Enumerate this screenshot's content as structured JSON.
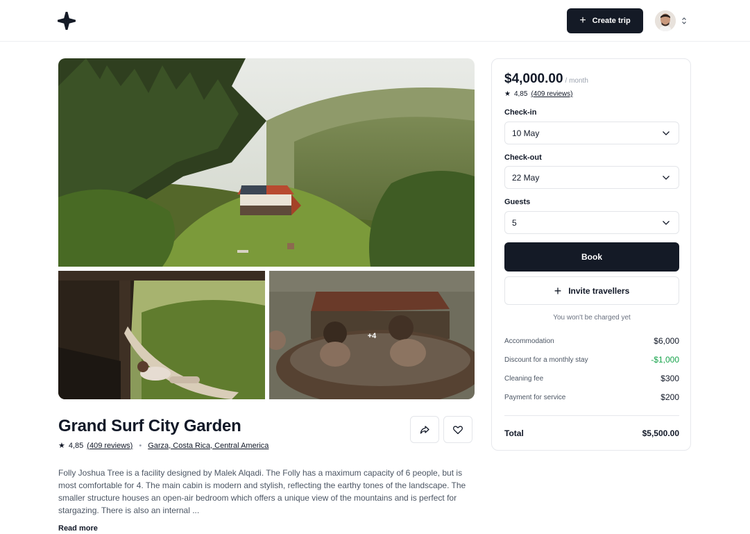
{
  "header": {
    "logo_icon": "sparkle-logo-icon",
    "create_trip_label": "Create trip",
    "create_icon": "plus-icon",
    "avatar_icon": "user-avatar",
    "menu_icon": "updown-caret-icon"
  },
  "gallery": {
    "main_photo": "cabin-in-forest",
    "left_photo": "hammock-on-porch",
    "right_photo": "hot-tub-by-cabin",
    "more_count": "+4"
  },
  "listing": {
    "title": "Grand Surf City Garden",
    "rating": "4,85",
    "reviews": "(409 reviews)",
    "location": "Garza, Costa Rica, Central America",
    "share_icon": "share-icon",
    "favorite_icon": "heart-icon",
    "description": "Folly Joshua Tree is a facility designed by Malek Alqadi. The Folly has a maximum capacity of 6 people, but is most comfortable for 4. The main cabin is modern and stylish, reflecting the earthy tones of the landscape. The smaller structure houses an open-air bedroom which offers a unique view of the mountains and is perfect for stargazing. There is also an internal ...",
    "read_more": "Read more"
  },
  "booking": {
    "price": "$4,000.00",
    "per": "/ month",
    "rating": "4,85",
    "reviews": "(409 reviews)",
    "checkin_label": "Check-in",
    "checkin_value": "10 May",
    "checkout_label": "Check-out",
    "checkout_value": "22 May",
    "guests_label": "Guests",
    "guests_value": "5",
    "book_label": "Book",
    "invite_label": "Invite travellers",
    "note": "You won't be charged yet",
    "lines": [
      {
        "label": "Accommodation",
        "value": "$6,000"
      },
      {
        "label": "Discount for a monthly stay",
        "value": "-$1,000"
      },
      {
        "label": "Cleaning fee",
        "value": "$300"
      },
      {
        "label": "Payment for service",
        "value": "$200"
      }
    ],
    "total_label": "Total",
    "total_value": "$5,500.00"
  },
  "colors": {
    "primary": "#141a26",
    "discount": "#16a34a",
    "border": "#e3e5e9"
  }
}
